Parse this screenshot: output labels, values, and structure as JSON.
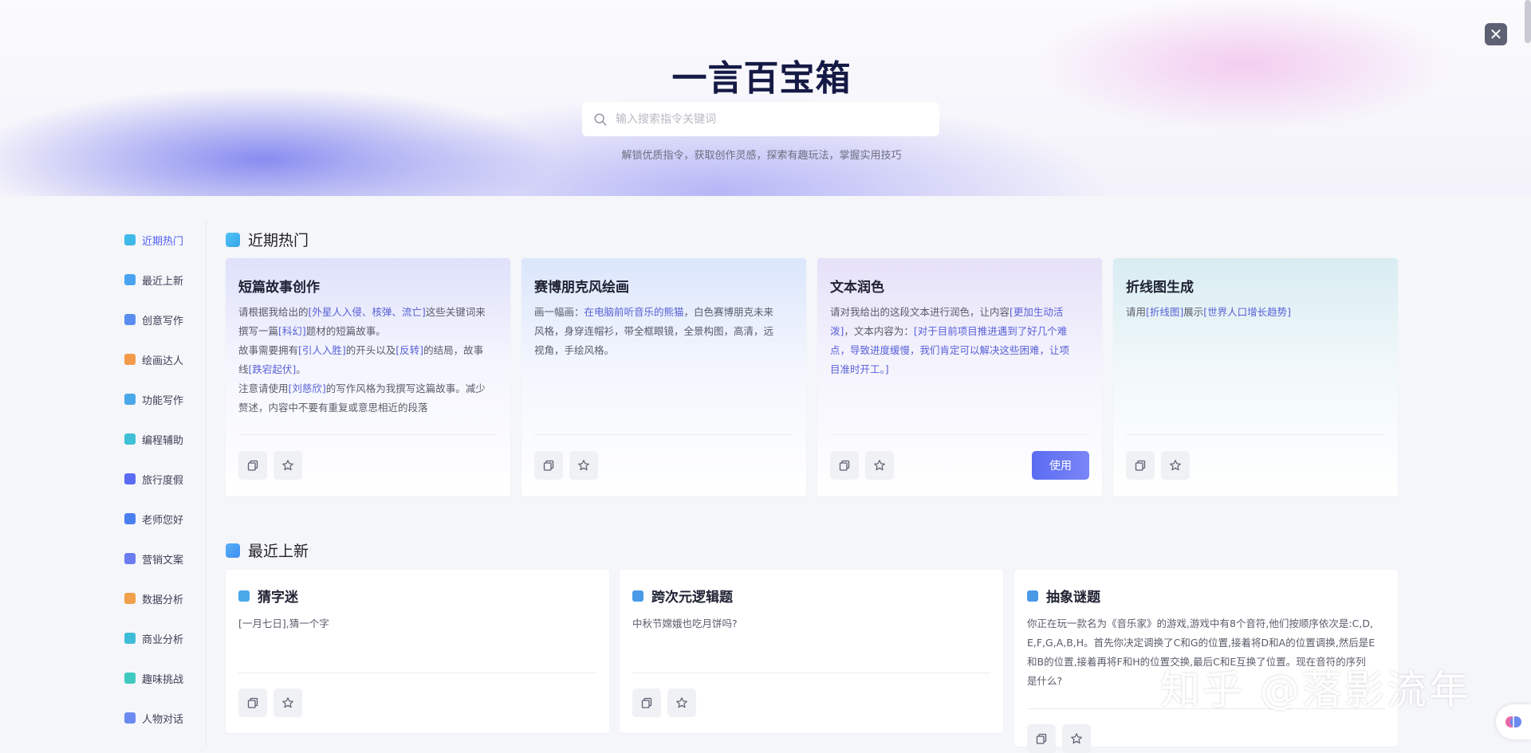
{
  "header": {
    "title": "一言百宝箱",
    "search_placeholder": "输入搜索指令关键词",
    "subtitle": "解锁优质指令，获取创作灵感，探索有趣玩法，掌握实用技巧"
  },
  "sidebar": {
    "items": [
      {
        "label": "近期热门",
        "color": "#3fb9e8"
      },
      {
        "label": "最近上新",
        "color": "#4aa3f0"
      },
      {
        "label": "创意写作",
        "color": "#5a8df0"
      },
      {
        "label": "绘画达人",
        "color": "#f39b4a"
      },
      {
        "label": "功能写作",
        "color": "#4aa8e8"
      },
      {
        "label": "编程辅助",
        "color": "#3fc0d6"
      },
      {
        "label": "旅行度假",
        "color": "#5b6cf3"
      },
      {
        "label": "老师您好",
        "color": "#4a7ff0"
      },
      {
        "label": "营销文案",
        "color": "#6a7cf0"
      },
      {
        "label": "数据分析",
        "color": "#f0a04a"
      },
      {
        "label": "商业分析",
        "color": "#3fbcd6"
      },
      {
        "label": "趣味挑战",
        "color": "#3fc9c0"
      },
      {
        "label": "人物对话",
        "color": "#6a8af0"
      }
    ]
  },
  "hot_section": {
    "title": "近期热门",
    "cards": [
      {
        "title": "短篇故事创作",
        "lines": [
          [
            {
              "t": "请根据我给出的"
            },
            {
              "t": "[外星人入侵、核弹、流亡]",
              "h": true
            },
            {
              "t": "这些关键词来"
            }
          ],
          [
            {
              "t": "撰写一篇"
            },
            {
              "t": "[科幻]",
              "h": true
            },
            {
              "t": "题材的短篇故事。"
            }
          ],
          [
            {
              "t": "故事需要拥有"
            },
            {
              "t": "[引人入胜]",
              "h": true
            },
            {
              "t": "的开头以及"
            },
            {
              "t": "[反转]",
              "h": true
            },
            {
              "t": "的结局，故事"
            }
          ],
          [
            {
              "t": "线"
            },
            {
              "t": "[跌宕起伏]",
              "h": true
            },
            {
              "t": "。"
            }
          ],
          [
            {
              "t": "注意请使用"
            },
            {
              "t": "[刘慈欣]",
              "h": true
            },
            {
              "t": "的写作风格为我撰写这篇故事。减少"
            }
          ],
          [
            {
              "t": "赘述，内容中不要有重复或意思相近的段落"
            }
          ]
        ]
      },
      {
        "title": "赛博朋克风绘画",
        "lines": [
          [
            {
              "t": "画一幅画："
            },
            {
              "t": "在电脑前听音乐的熊猫",
              "h": true
            },
            {
              "t": "，白色赛博朋克未来"
            }
          ],
          [
            {
              "t": "风格，身穿连帽衫，带全框眼镜，全景构图，高清，远"
            }
          ],
          [
            {
              "t": "视角，手绘风格。"
            }
          ]
        ]
      },
      {
        "title": "文本润色",
        "use_label": "使用",
        "lines": [
          [
            {
              "t": "请对我给出的这段文本进行润色，让内容"
            },
            {
              "t": "[更加生动活",
              "h": true
            }
          ],
          [
            {
              "t": "泼]",
              "h": true
            },
            {
              "t": "，文本内容为："
            },
            {
              "t": "[对于目前项目推进遇到了好几个难",
              "h": true
            }
          ],
          [
            {
              "t": "点，导致进度缓慢，我们肯定可以解决这些困难，让项",
              "h": true
            }
          ],
          [
            {
              "t": "目准时开工。]",
              "h": true
            }
          ]
        ]
      },
      {
        "title": "折线图生成",
        "lines": [
          [
            {
              "t": "请用"
            },
            {
              "t": "[折线图]",
              "h": true
            },
            {
              "t": "展示"
            },
            {
              "t": "[世界人口增长趋势]",
              "h": true
            }
          ]
        ]
      }
    ]
  },
  "new_section": {
    "title": "最近上新",
    "cards": [
      {
        "title": "猜字迷",
        "lines": [
          [
            {
              "t": "[一月七日],猜一个字"
            }
          ]
        ]
      },
      {
        "title": "跨次元逻辑题",
        "lines": [
          [
            {
              "t": "中秋节嫦娥也吃月饼吗?"
            }
          ]
        ]
      },
      {
        "title": "抽象谜题",
        "lines": [
          [
            {
              "t": "你正在玩一款名为《音乐家》的游戏,游戏中有8个音符,他们按顺序依次是:C,D,"
            }
          ],
          [
            {
              "t": "E,F,G,A,B,H。首先你决定调换了C和G的位置,接着将D和A的位置调换,然后是E"
            }
          ],
          [
            {
              "t": "和B的位置,接着再将F和H的位置交换,最后C和E互换了位置。现在音符的序列"
            }
          ],
          [
            {
              "t": "是什么?"
            }
          ]
        ]
      }
    ]
  },
  "watermark": "知乎 @落影流年"
}
